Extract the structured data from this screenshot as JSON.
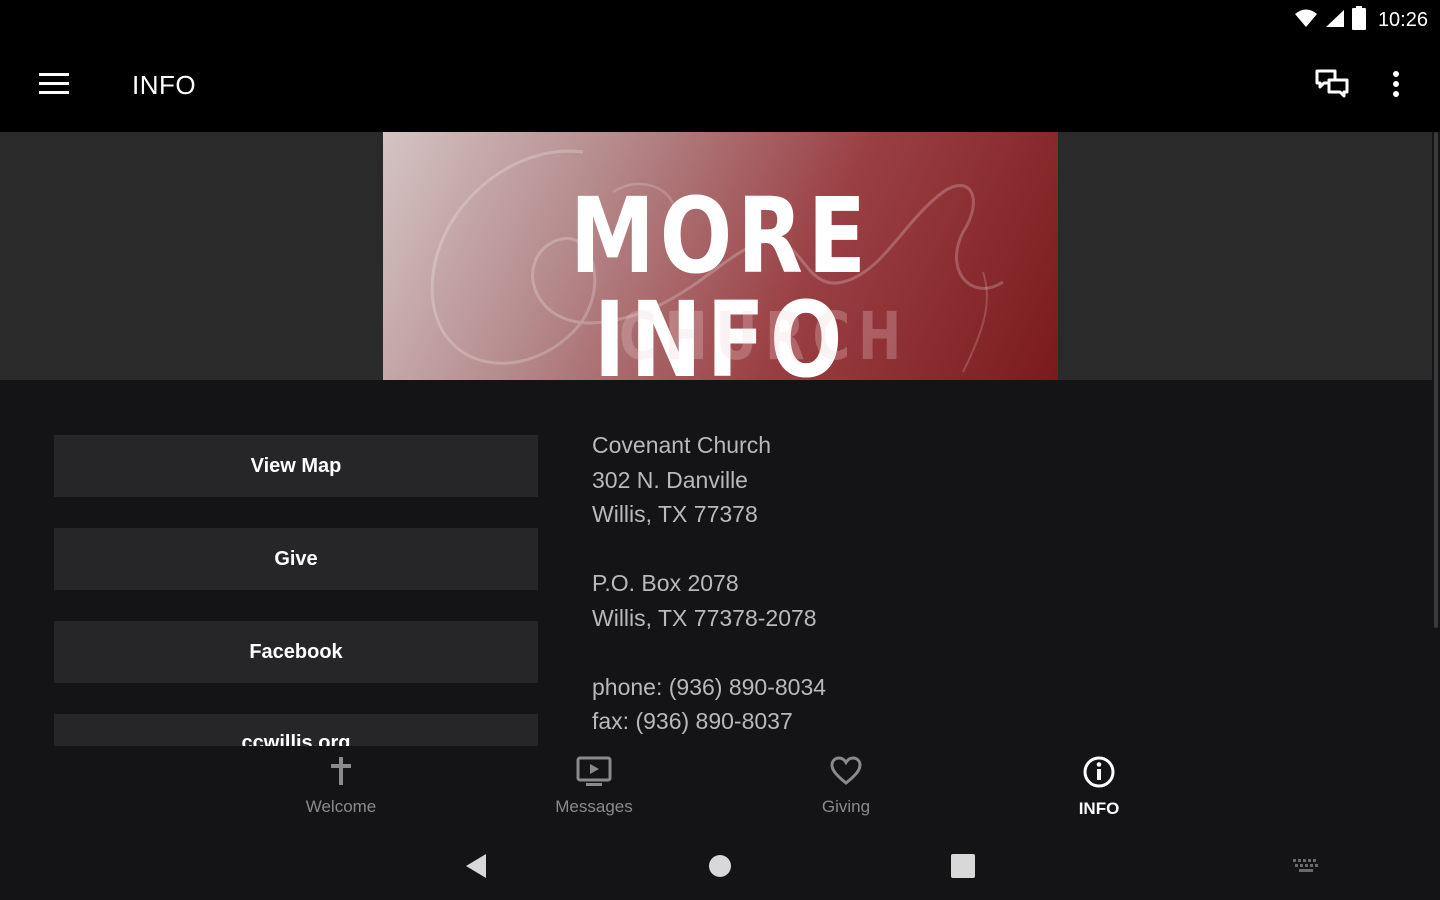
{
  "status_bar": {
    "time": "10:26",
    "icons": [
      "wifi-icon",
      "cell-signal-icon",
      "battery-icon"
    ]
  },
  "app_bar": {
    "title": "INFO",
    "menu_icon": "menu-icon",
    "chat_icon": "chat-icon",
    "overflow_icon": "more-vert-icon"
  },
  "banner": {
    "title": "MORE INFO",
    "subtitle": "CHURCH"
  },
  "buttons": [
    {
      "label": "View Map"
    },
    {
      "label": "Give"
    },
    {
      "label": "Facebook"
    },
    {
      "label": "ccwillis.org"
    }
  ],
  "contact": {
    "name": "Covenant Church",
    "street": "302 N. Danville",
    "city_line": "Willis, TX  77378",
    "po_box": "P.O. Box 2078",
    "po_city_line": "Willis, TX  77378-2078",
    "phone": "phone: (936) 890-8034",
    "fax": "fax: (936) 890-8037"
  },
  "bottom_nav": [
    {
      "label": "Welcome",
      "icon": "cross-icon",
      "active": false
    },
    {
      "label": "Messages",
      "icon": "video-screen-icon",
      "active": false
    },
    {
      "label": "Giving",
      "icon": "heart-icon",
      "active": false
    },
    {
      "label": "INFO",
      "icon": "info-icon",
      "active": true
    }
  ],
  "colors": {
    "background": "#000000",
    "content_bg": "#141416",
    "button_bg": "#262628",
    "banner_dark_red": "#7b1a1d",
    "text_muted": "#b9b9bb"
  }
}
